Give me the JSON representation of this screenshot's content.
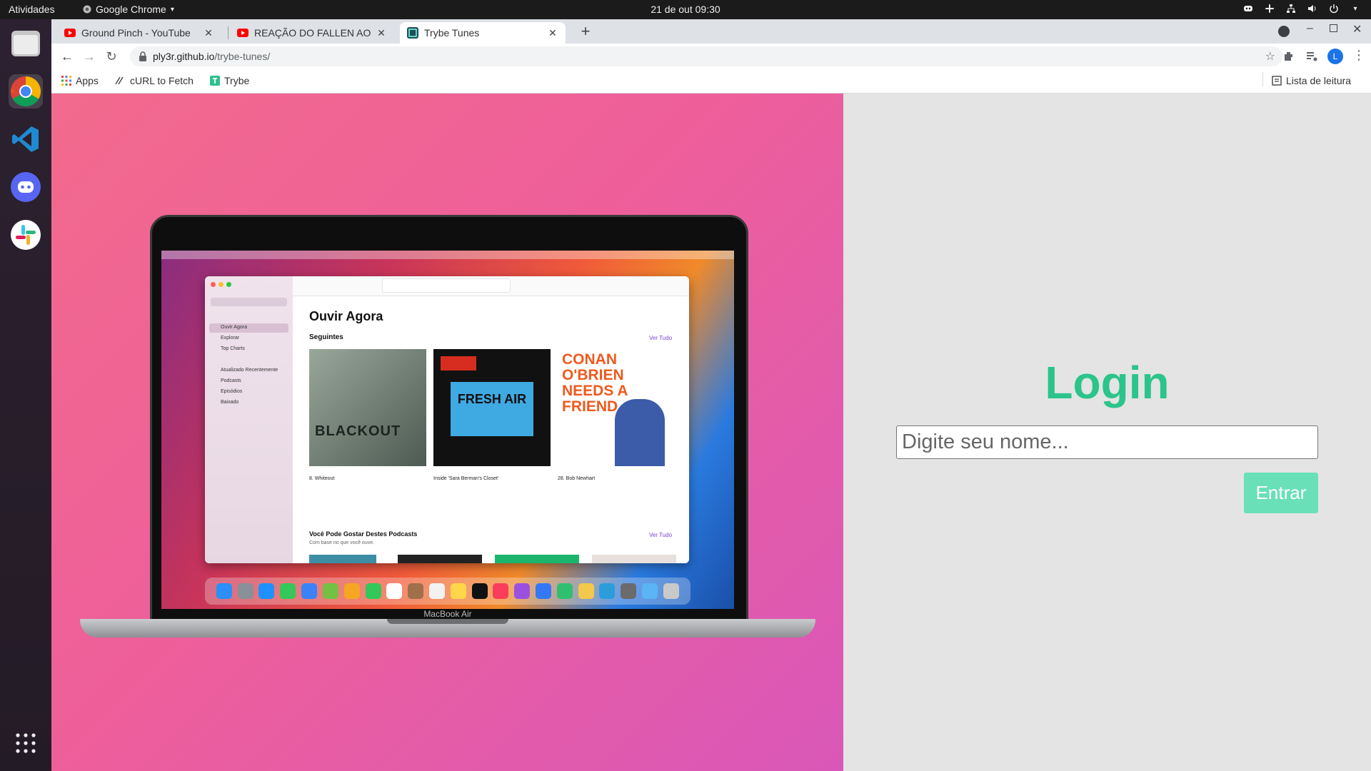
{
  "topbar": {
    "activities": "Atividades",
    "app_name": "Google Chrome",
    "datetime": "21 de out  09:30"
  },
  "dock": {
    "items": [
      "files-icon",
      "chrome-icon",
      "vscode-icon",
      "discord-icon",
      "slack-icon"
    ],
    "apps_grid": "apps-grid-icon"
  },
  "tabs": [
    {
      "title": "Ground Pinch - YouTube",
      "icon": "youtube-icon"
    },
    {
      "title": "REAÇÃO DO FALLEN AO",
      "icon": "youtube-icon"
    },
    {
      "title": "Trybe Tunes",
      "icon": "trybe-icon",
      "active": true
    }
  ],
  "address": {
    "domain": "ply3r.github.io",
    "path": "/trybe-tunes/"
  },
  "profile_initial": "L",
  "bookmarks": {
    "apps": "Apps",
    "curl": "cURL to Fetch",
    "trybe": "Trybe",
    "reading_list": "Lista de leitura"
  },
  "login": {
    "title": "Login",
    "input_placeholder": "Digite seu nome...",
    "button": "Entrar"
  },
  "laptop": {
    "brand": "MacBook Air",
    "podcasts": {
      "heading": "Ouvir Agora",
      "section1": "Seguintes",
      "see_all": "Ver Tudo",
      "section2": "Você Pode Gostar Destes Podcasts",
      "section2_sub": "Com base no que você ouve.",
      "sidebar": [
        "Ouvir Agora",
        "Explorar",
        "Top Charts",
        "Atualizado Recentemente",
        "Podcasts",
        "Episódios",
        "Baixado"
      ],
      "shows": [
        {
          "cover": "BLACKOUT",
          "episode": "8. Whiteout"
        },
        {
          "cover": "FRESH AIR",
          "episode": "Inside 'Sara Berman's Closet'"
        },
        {
          "cover": "CONAN O'BRIEN NEEDS A FRIEND",
          "episode": "28. Bob Newhart"
        }
      ]
    }
  },
  "colors": {
    "accent": "#2bc48a",
    "button": "#69e0b8",
    "hero_start": "#f26a8d",
    "hero_end": "#d957b8"
  }
}
